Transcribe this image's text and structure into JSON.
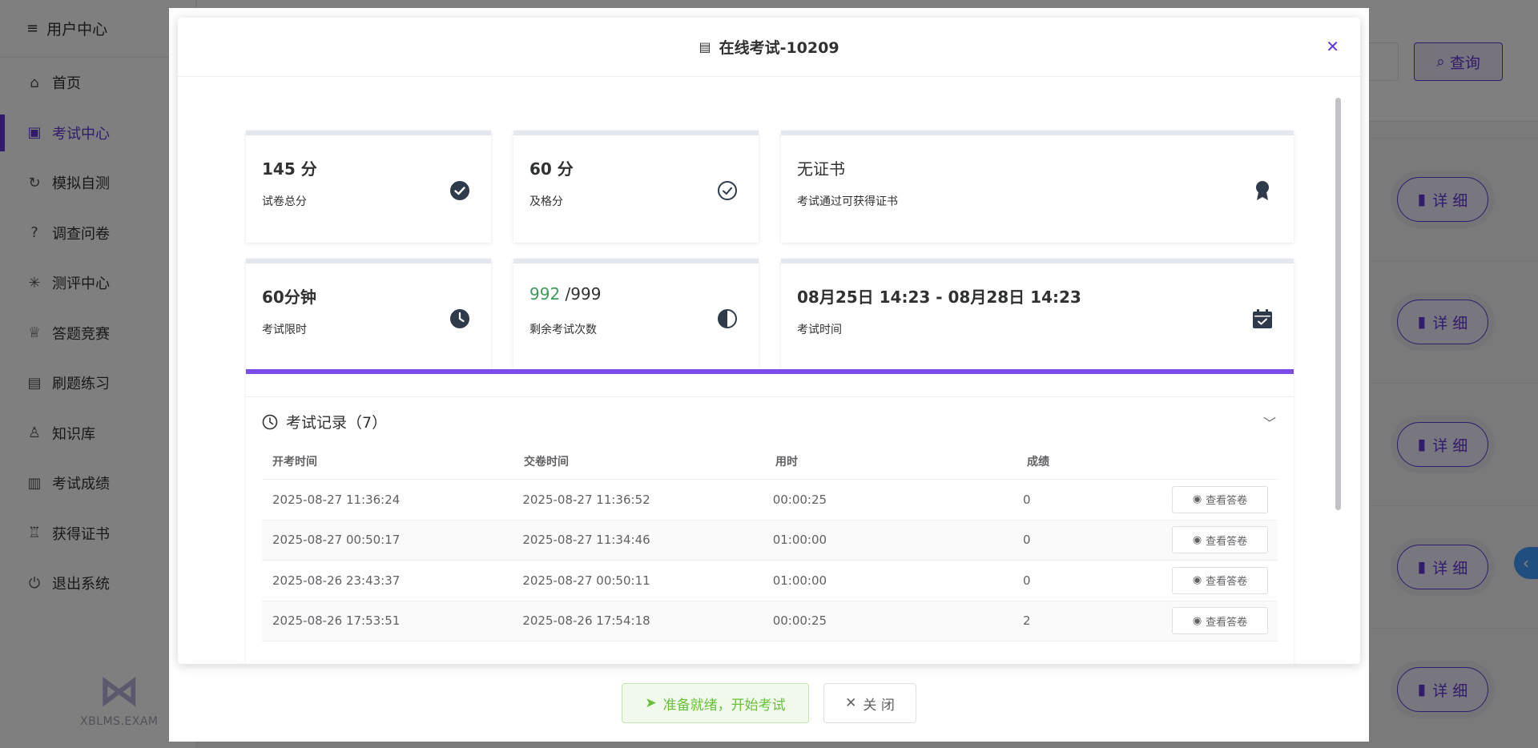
{
  "sidebar": {
    "header": "用户中心",
    "items": [
      {
        "label": "首页",
        "icon": "home-icon"
      },
      {
        "label": "考试中心",
        "icon": "exam-icon",
        "active": true
      },
      {
        "label": "模拟自测",
        "icon": "refresh-icon"
      },
      {
        "label": "调查问卷",
        "icon": "question-icon"
      },
      {
        "label": "测评中心",
        "icon": "spinner-icon"
      },
      {
        "label": "答题竞赛",
        "icon": "trophy-icon"
      },
      {
        "label": "刷题练习",
        "icon": "clipboard-icon"
      },
      {
        "label": "知识库",
        "icon": "knowledge-icon"
      },
      {
        "label": "考试成绩",
        "icon": "score-icon"
      },
      {
        "label": "获得证书",
        "icon": "certificate-icon"
      },
      {
        "label": "退出系统",
        "icon": "power-icon"
      }
    ],
    "logo_text": "XBLMS.EXAM"
  },
  "background": {
    "query_label": "查询",
    "detail_label": "详 细"
  },
  "modal": {
    "title": "在线考试-10209",
    "cards": {
      "total_score": {
        "value": "145 分",
        "label": "试卷总分"
      },
      "pass_score": {
        "value": "60 分",
        "label": "及格分"
      },
      "certificate": {
        "value": "无证书",
        "label": "考试通过可获得证书"
      },
      "time_limit": {
        "value": "60分钟",
        "label": "考试限时"
      },
      "attempts": {
        "remaining": "992",
        "total": "/999",
        "label": "剩余考试次数"
      },
      "exam_time": {
        "value": "08月25日 14:23 - 08月28日 14:23",
        "label": "考试时间"
      }
    },
    "records": {
      "title": "考试记录（7）",
      "columns": [
        "开考时间",
        "交卷时间",
        "用时",
        "成绩"
      ],
      "view_label": "查看答卷",
      "rows": [
        {
          "start": "2025-08-27 11:36:24",
          "submit": "2025-08-27 11:36:52",
          "duration": "00:00:25",
          "score": "0"
        },
        {
          "start": "2025-08-27 00:50:17",
          "submit": "2025-08-27 11:34:46",
          "duration": "01:00:00",
          "score": "0"
        },
        {
          "start": "2025-08-26 23:43:37",
          "submit": "2025-08-27 00:50:11",
          "duration": "01:00:00",
          "score": "0"
        },
        {
          "start": "2025-08-26 17:53:51",
          "submit": "2025-08-26 17:54:18",
          "duration": "00:00:25",
          "score": "2"
        }
      ]
    },
    "footer": {
      "start_label": "准备就绪，开始考试",
      "close_label": "关 闭"
    }
  },
  "colors": {
    "accent": "#6236d6",
    "progress_bar": "#7c4ce8",
    "success": "#67c23a",
    "remaining_green": "#3f9b5a"
  }
}
